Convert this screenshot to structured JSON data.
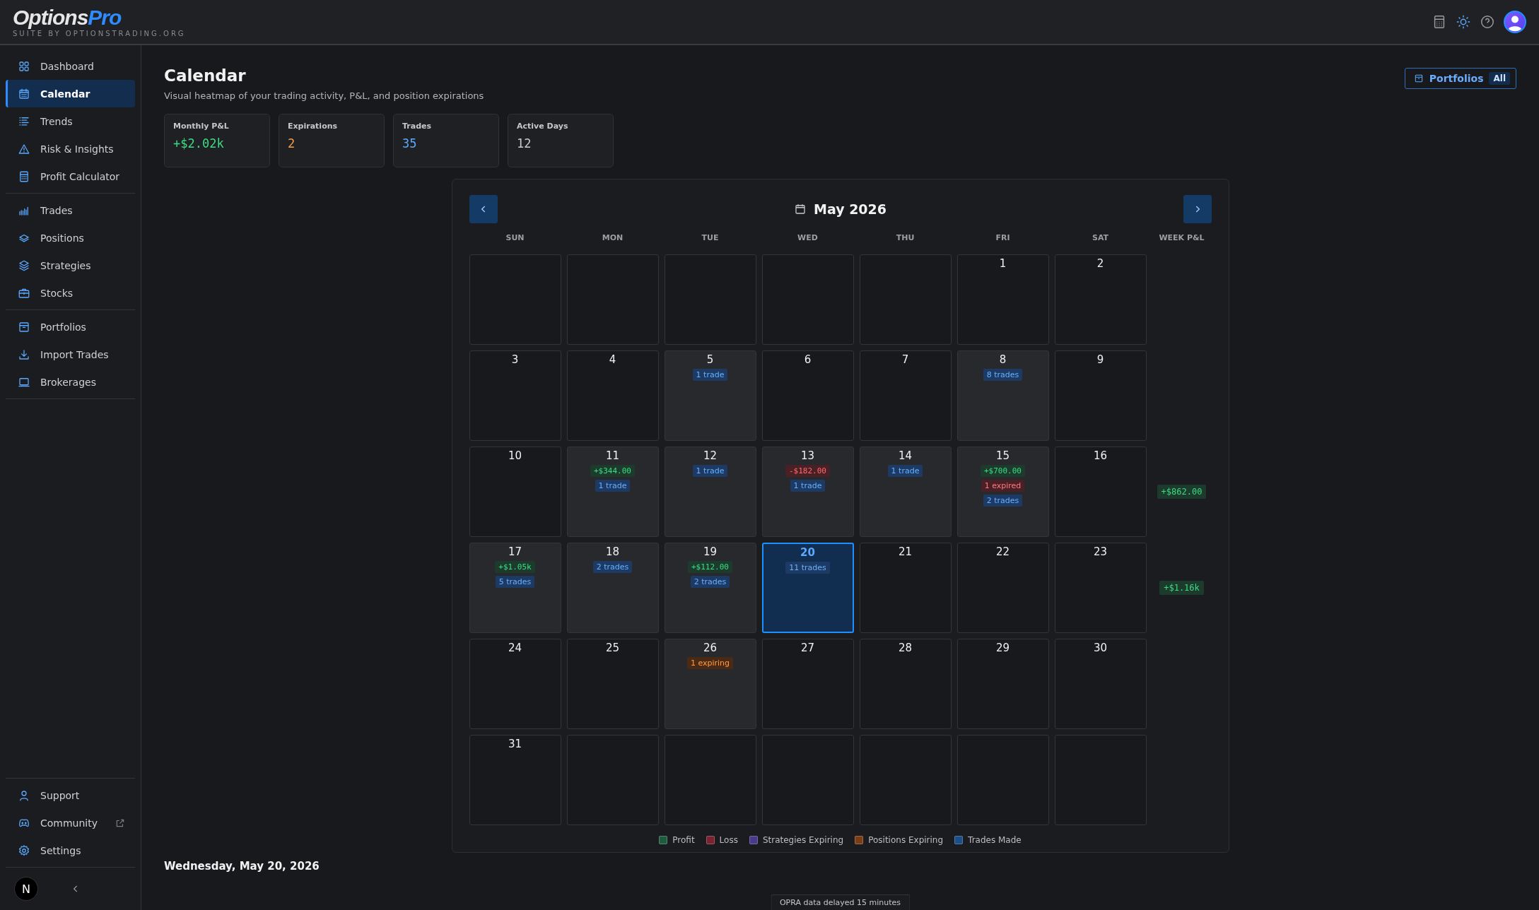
{
  "brand": {
    "name_main": "Options",
    "name_accent": "Pro",
    "tagline": "SUITE BY OPTIONSTRADING.ORG"
  },
  "sidebar": {
    "groups": [
      {
        "items": [
          {
            "label": "Dashboard",
            "selected": false
          },
          {
            "label": "Calendar",
            "selected": true
          },
          {
            "label": "Trends",
            "selected": false
          },
          {
            "label": "Risk & Insights",
            "selected": false
          },
          {
            "label": "Profit Calculator",
            "selected": false
          }
        ]
      },
      {
        "items": [
          {
            "label": "Trades",
            "selected": false
          },
          {
            "label": "Positions",
            "selected": false
          },
          {
            "label": "Strategies",
            "selected": false
          },
          {
            "label": "Stocks",
            "selected": false
          }
        ]
      },
      {
        "items": [
          {
            "label": "Portfolios",
            "selected": false
          },
          {
            "label": "Import Trades",
            "selected": false
          },
          {
            "label": "Brokerages",
            "selected": false
          }
        ]
      }
    ],
    "footer_items": [
      {
        "label": "Support",
        "external": false
      },
      {
        "label": "Community",
        "external": true
      },
      {
        "label": "Settings",
        "external": false
      }
    ],
    "badge": "N"
  },
  "page": {
    "title": "Calendar",
    "subtitle": "Visual heatmap of your trading activity, P&L, and position expirations",
    "portfolio_button": "Portfolios",
    "portfolio_filter": "All"
  },
  "stats": [
    {
      "label": "Monthly P&L",
      "value": "+$2.02k",
      "kind": "profit"
    },
    {
      "label": "Expirations",
      "value": "2",
      "kind": "expiring"
    },
    {
      "label": "Trades",
      "value": "35",
      "kind": "trades"
    },
    {
      "label": "Active Days",
      "value": "12",
      "kind": "neutral"
    }
  ],
  "calendar": {
    "month": "May 2026",
    "weekdays": [
      "SUN",
      "MON",
      "TUE",
      "WED",
      "THU",
      "FRI",
      "SAT"
    ],
    "week_column": "WEEK P&L",
    "weeks": [
      {
        "days": [
          {
            "kind": "blank"
          },
          {
            "kind": "blank"
          },
          {
            "kind": "blank"
          },
          {
            "kind": "blank"
          },
          {
            "kind": "blank"
          },
          {
            "kind": "day",
            "day": "1",
            "active": false,
            "selected": false
          },
          {
            "kind": "day",
            "day": "2",
            "active": false,
            "selected": false
          }
        ]
      },
      {
        "days": [
          {
            "kind": "day",
            "day": "3",
            "active": false,
            "selected": false
          },
          {
            "kind": "day",
            "day": "4",
            "active": false,
            "selected": false
          },
          {
            "kind": "day",
            "day": "5",
            "active": true,
            "selected": false,
            "tags": [
              {
                "kind": "trades",
                "text": "1 trade"
              }
            ]
          },
          {
            "kind": "day",
            "day": "6",
            "active": false,
            "selected": false
          },
          {
            "kind": "day",
            "day": "7",
            "active": false,
            "selected": false
          },
          {
            "kind": "day",
            "day": "8",
            "active": true,
            "selected": false,
            "tags": [
              {
                "kind": "trades",
                "text": "8 trades"
              }
            ]
          },
          {
            "kind": "day",
            "day": "9",
            "active": false,
            "selected": false
          }
        ]
      },
      {
        "week_pnl": "+$862.00",
        "days": [
          {
            "kind": "day",
            "day": "10",
            "active": false,
            "selected": false
          },
          {
            "kind": "day",
            "day": "11",
            "active": true,
            "selected": false,
            "tags": [
              {
                "kind": "profit",
                "text": "+$344.00"
              },
              {
                "kind": "trades",
                "text": "1 trade"
              }
            ]
          },
          {
            "kind": "day",
            "day": "12",
            "active": true,
            "selected": false,
            "tags": [
              {
                "kind": "trades",
                "text": "1 trade"
              }
            ]
          },
          {
            "kind": "day",
            "day": "13",
            "active": true,
            "selected": false,
            "tags": [
              {
                "kind": "loss",
                "text": "-$182.00"
              },
              {
                "kind": "trades",
                "text": "1 trade"
              }
            ]
          },
          {
            "kind": "day",
            "day": "14",
            "active": true,
            "selected": false,
            "tags": [
              {
                "kind": "trades",
                "text": "1 trade"
              }
            ]
          },
          {
            "kind": "day",
            "day": "15",
            "active": true,
            "selected": false,
            "tags": [
              {
                "kind": "profit",
                "text": "+$700.00"
              },
              {
                "kind": "expired",
                "text": "1 expired"
              },
              {
                "kind": "trades",
                "text": "2 trades"
              }
            ]
          },
          {
            "kind": "day",
            "day": "16",
            "active": false,
            "selected": false
          }
        ]
      },
      {
        "week_pnl": "+$1.16k",
        "days": [
          {
            "kind": "day",
            "day": "17",
            "active": true,
            "selected": false,
            "tags": [
              {
                "kind": "profit",
                "text": "+$1.05k"
              },
              {
                "kind": "trades",
                "text": "5 trades"
              }
            ]
          },
          {
            "kind": "day",
            "day": "18",
            "active": true,
            "selected": false,
            "tags": [
              {
                "kind": "trades",
                "text": "2 trades"
              }
            ]
          },
          {
            "kind": "day",
            "day": "19",
            "active": true,
            "selected": false,
            "tags": [
              {
                "kind": "profit",
                "text": "+$112.00"
              },
              {
                "kind": "trades",
                "text": "2 trades"
              }
            ]
          },
          {
            "kind": "day",
            "day": "20",
            "active": true,
            "selected": true,
            "tags": [
              {
                "kind": "trades",
                "text": "11 trades"
              }
            ]
          },
          {
            "kind": "day",
            "day": "21",
            "active": false,
            "selected": false
          },
          {
            "kind": "day",
            "day": "22",
            "active": false,
            "selected": false
          },
          {
            "kind": "day",
            "day": "23",
            "active": false,
            "selected": false
          }
        ]
      },
      {
        "days": [
          {
            "kind": "day",
            "day": "24",
            "active": false,
            "selected": false
          },
          {
            "kind": "day",
            "day": "25",
            "active": false,
            "selected": false
          },
          {
            "kind": "day",
            "day": "26",
            "active": true,
            "selected": false,
            "tags": [
              {
                "kind": "expiring",
                "text": "1 expiring"
              }
            ]
          },
          {
            "kind": "day",
            "day": "27",
            "active": false,
            "selected": false
          },
          {
            "kind": "day",
            "day": "28",
            "active": false,
            "selected": false
          },
          {
            "kind": "day",
            "day": "29",
            "active": false,
            "selected": false
          },
          {
            "kind": "day",
            "day": "30",
            "active": false,
            "selected": false
          }
        ]
      },
      {
        "days": [
          {
            "kind": "day",
            "day": "31",
            "active": false,
            "selected": false
          },
          {
            "kind": "blank"
          },
          {
            "kind": "blank"
          },
          {
            "kind": "blank"
          },
          {
            "kind": "blank"
          },
          {
            "kind": "blank"
          },
          {
            "kind": "blank"
          }
        ]
      }
    ],
    "legend": [
      {
        "label": "Profit",
        "color": "#1f5c3f"
      },
      {
        "label": "Loss",
        "color": "#7a2230"
      },
      {
        "label": "Strategies Expiring",
        "color": "#4a3a8a"
      },
      {
        "label": "Positions Expiring",
        "color": "#7a3e17"
      },
      {
        "label": "Trades Made",
        "color": "#1c4e8a"
      }
    ]
  },
  "status_note": "OPRA data delayed 15 minutes",
  "selected_date": "Wednesday, May 20, 2026"
}
